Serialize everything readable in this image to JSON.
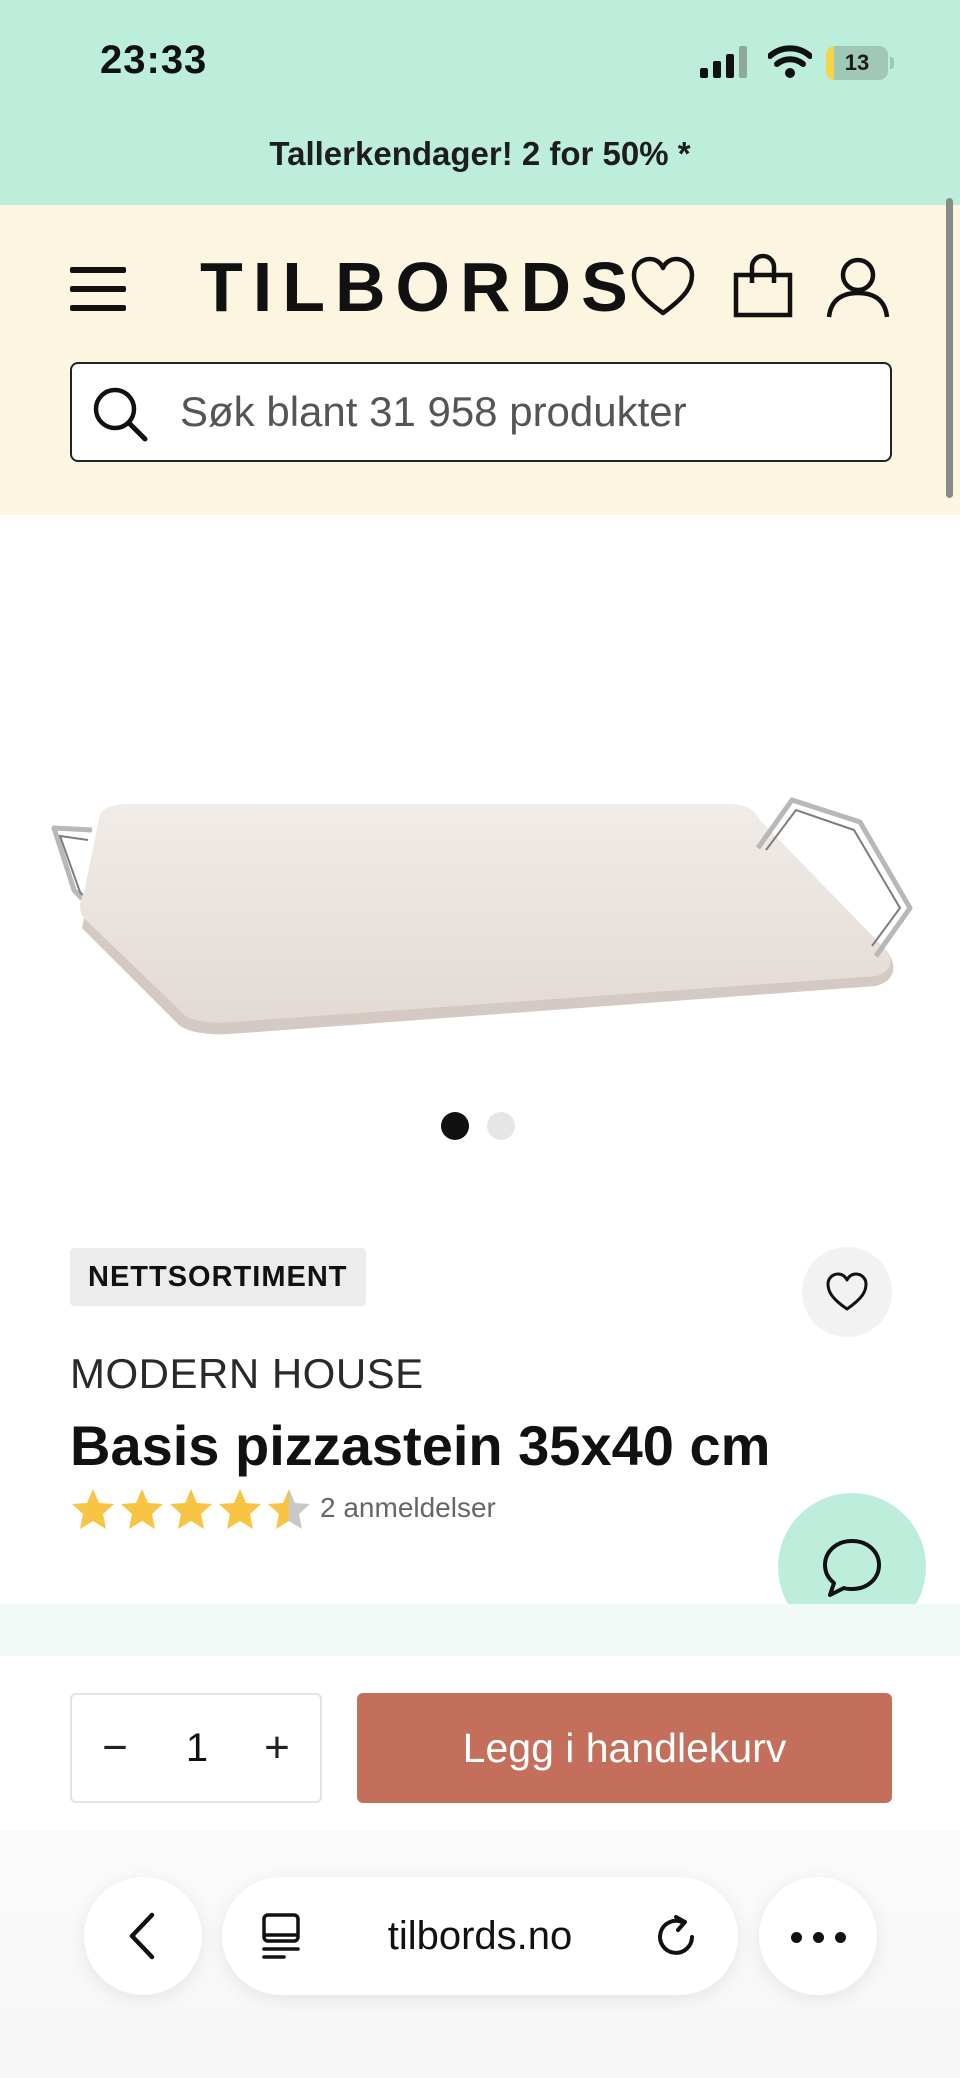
{
  "status_bar": {
    "time": "23:33",
    "battery_level": "13",
    "signal_icon": "cellular-signal-icon",
    "wifi_icon": "wifi-icon",
    "battery_icon": "battery-icon"
  },
  "promo_banner": {
    "text": "Tallerkendager! 2 for 50% *"
  },
  "header": {
    "logo": "TILBORDS",
    "menu_icon": "hamburger-menu-icon",
    "wishlist_icon": "heart-icon",
    "cart_icon": "shopping-bag-icon",
    "account_icon": "user-icon",
    "search": {
      "icon": "search-icon",
      "placeholder": "Søk blant 31 958 produkter"
    }
  },
  "product": {
    "image_carousel": {
      "total_images": 2,
      "active_index": 0
    },
    "badge": "NETTSORTIMENT",
    "brand": "MODERN HOUSE",
    "title": "Basis pizzastein 35x40 cm",
    "rating": {
      "value": 4.5,
      "max": 5,
      "review_count_text": "2 anmeldelser"
    },
    "wishlist_icon": "heart-icon"
  },
  "chat": {
    "icon": "chat-bubble-icon"
  },
  "cart_controls": {
    "quantity_minus": "−",
    "quantity": "1",
    "quantity_plus": "+",
    "add_to_cart_label": "Legg i handlekurv"
  },
  "browser": {
    "url": "tilbords.no",
    "back_icon": "chevron-left-icon",
    "tabs_icon": "tabs-icon",
    "reload_icon": "reload-icon",
    "more_icon": "more-horizontal-icon"
  },
  "colors": {
    "mint": "#bdeedb",
    "cream": "#fcf5e0",
    "terracotta_button": "#c46f5c",
    "star_gold": "#f7c443",
    "star_gray": "#c8c8c8"
  }
}
